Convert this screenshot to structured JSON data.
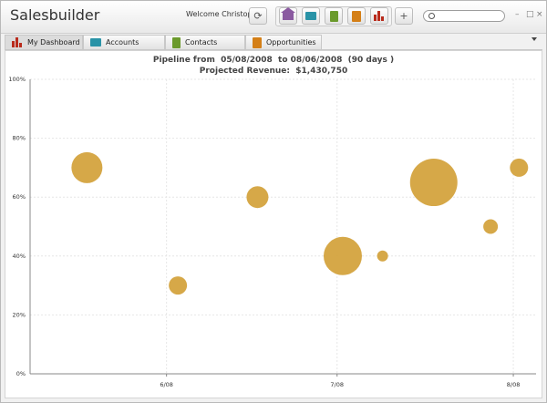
{
  "app": {
    "title": "Salesbuilder",
    "welcome": "Welcome Christophe"
  },
  "toolbar": {
    "refresh_icon": "refresh-icon",
    "home_icon": "home-icon",
    "accounts_icon": "folder-icon",
    "contacts_icon": "book-icon",
    "opportunities_icon": "note-icon",
    "dashboard_icon": "bar-chart-icon",
    "add_label": "+"
  },
  "search": {
    "placeholder": ""
  },
  "window_controls": {
    "minimize": "–",
    "maximize": "□",
    "close": "×"
  },
  "tabs": [
    {
      "label": "My Dashboard",
      "icon": "bar-chart-icon",
      "color": "#b92b1c"
    },
    {
      "label": "Accounts",
      "icon": "folder-icon",
      "color": "#2a93a7"
    },
    {
      "label": "Contacts",
      "icon": "book-icon",
      "color": "#6b9a2c"
    },
    {
      "label": "Opportunities",
      "icon": "note-icon",
      "color": "#d47f17"
    }
  ],
  "chart_data": {
    "type": "scatter",
    "title": "Pipeline from  05/08/2008  to 08/06/2008  (90 days )",
    "subtitle": "Projected Revenue:  $1,430,750",
    "ylim": [
      0,
      100
    ],
    "yticks": [
      "0%",
      "20%",
      "40%",
      "60%",
      "80%",
      "100%"
    ],
    "xticks": [
      {
        "label": "6/08",
        "value": 24
      },
      {
        "label": "7/08",
        "value": 54
      },
      {
        "label": "8/08",
        "value": 85
      }
    ],
    "xlim": [
      0,
      89
    ],
    "grid": true,
    "bubble_color": "#d4a33e",
    "points": [
      {
        "x": 10,
        "y": 70,
        "size": 17
      },
      {
        "x": 26,
        "y": 30,
        "size": 10
      },
      {
        "x": 40,
        "y": 60,
        "size": 12
      },
      {
        "x": 55,
        "y": 40,
        "size": 21
      },
      {
        "x": 62,
        "y": 40,
        "size": 6
      },
      {
        "x": 71,
        "y": 65,
        "size": 26
      },
      {
        "x": 81,
        "y": 50,
        "size": 8
      },
      {
        "x": 86,
        "y": 70,
        "size": 10
      }
    ]
  }
}
